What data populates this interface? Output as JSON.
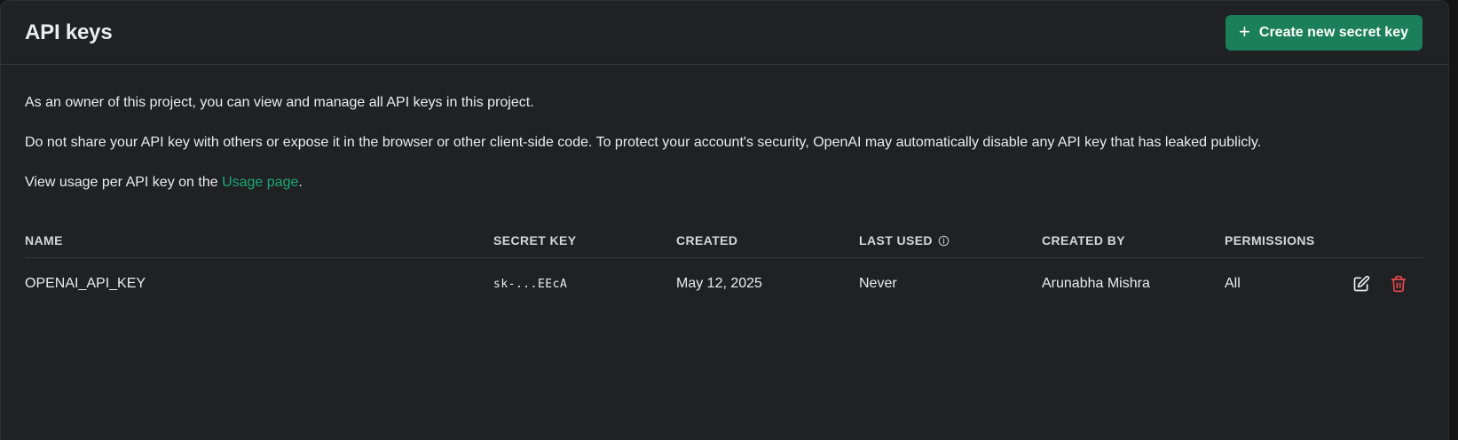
{
  "header": {
    "title": "API keys",
    "create_button_label": "Create new secret key"
  },
  "intro": {
    "p1": "As an owner of this project, you can view and manage all API keys in this project.",
    "p2": "Do not share your API key with others or expose it in the browser or other client-side code. To protect your account's security, OpenAI may automatically disable any API key that has leaked publicly.",
    "p3_prefix": "View usage per API key on the ",
    "p3_link": "Usage page",
    "p3_suffix": "."
  },
  "table": {
    "columns": {
      "name": "NAME",
      "secret_key": "SECRET KEY",
      "created": "CREATED",
      "last_used": "LAST USED",
      "created_by": "CREATED BY",
      "permissions": "PERMISSIONS"
    },
    "rows": [
      {
        "name": "OPENAI_API_KEY",
        "secret_key": "sk-...EEcA",
        "created": "May 12, 2025",
        "last_used": "Never",
        "created_by": "Arunabha Mishra",
        "permissions": "All"
      }
    ]
  },
  "colors": {
    "accent": "#1a7f5a",
    "link": "#19a974",
    "danger": "#e5484d",
    "panel": "#202123"
  },
  "icons": {
    "create": "plus-icon",
    "info": "info-icon",
    "edit": "edit-icon",
    "delete": "trash-icon"
  }
}
